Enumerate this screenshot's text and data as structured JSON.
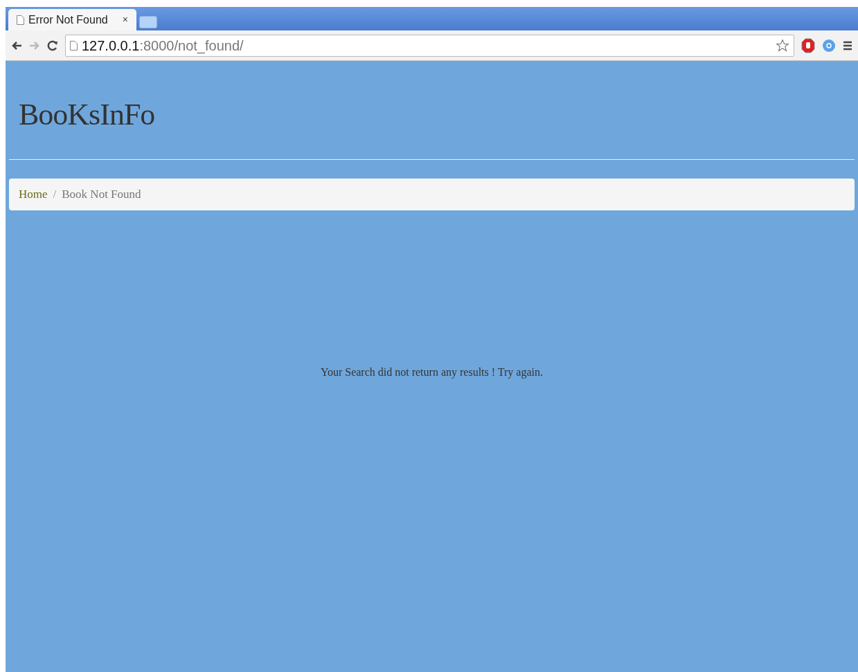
{
  "browser": {
    "tabs": [
      {
        "title": "Error Not Found",
        "close": "×",
        "selected": true
      }
    ],
    "address": {
      "host": "127.0.0.1",
      "path": ":8000/not_found/"
    }
  },
  "page": {
    "brand": "BooKsInFo",
    "breadcrumb": [
      {
        "label": "Home",
        "kind": "link"
      },
      {
        "label": "Book Not Found",
        "kind": "current"
      }
    ],
    "separator": "/",
    "message": "Your Search did not return any results ! Try again."
  }
}
